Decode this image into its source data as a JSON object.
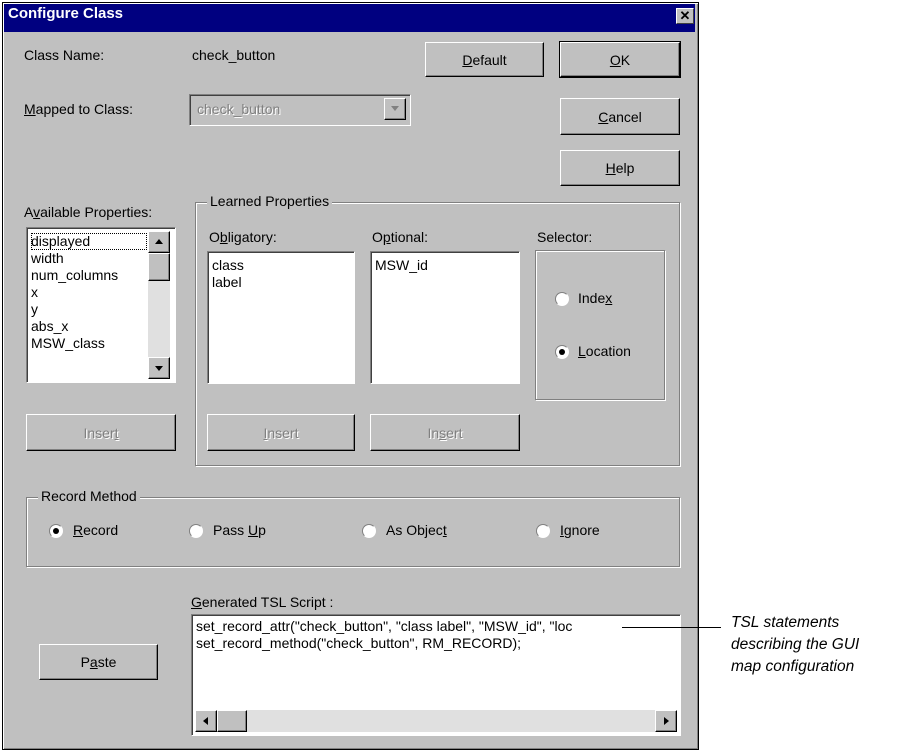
{
  "dialog": {
    "title": "Configure Class",
    "close_glyph": "✕"
  },
  "class_name": {
    "label": "Class Name:",
    "value": "check_button"
  },
  "mapped_to": {
    "label": "Mapped to Class:",
    "value": "check_button"
  },
  "buttons": {
    "default": "Default",
    "ok": "OK",
    "cancel": "Cancel",
    "help": "Help",
    "paste": "Paste",
    "insert": "Insert"
  },
  "available": {
    "label": "Available Properties:",
    "items": [
      "displayed",
      "width",
      "num_columns",
      "x",
      "y",
      "abs_x",
      "MSW_class"
    ]
  },
  "learned": {
    "label": "Learned Properties",
    "obligatory": {
      "label": "Obligatory:",
      "items": [
        "class",
        "label"
      ]
    },
    "optional": {
      "label": "Optional:",
      "items": [
        "MSW_id"
      ]
    },
    "selector": {
      "label": "Selector:",
      "options": [
        "Index",
        "Location"
      ],
      "selected": "Location"
    }
  },
  "record_method": {
    "label": "Record Method",
    "options": [
      "Record",
      "Pass Up",
      "As Object",
      "Ignore"
    ],
    "selected": "Record"
  },
  "script": {
    "label": "Generated TSL Script :",
    "lines": [
      "set_record_attr(\"check_button\", \"class label\", \"MSW_id\", \"loc",
      "set_record_method(\"check_button\", RM_RECORD);"
    ]
  },
  "annotation": {
    "lines": [
      "TSL statements",
      "describing the GUI",
      "map configuration"
    ]
  }
}
